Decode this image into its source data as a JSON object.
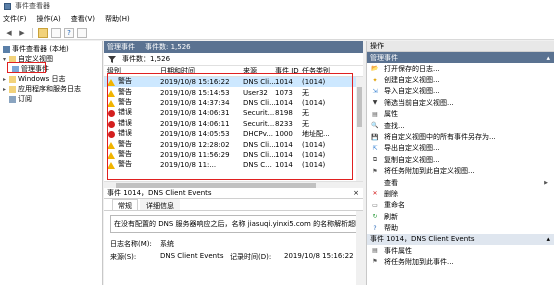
{
  "window": {
    "title": "事件查看器"
  },
  "menu": [
    "文件(F)",
    "操作(A)",
    "查看(V)",
    "帮助(H)"
  ],
  "tree": {
    "root": "事件查看器 (本地)",
    "custom_views": "自定义视图",
    "admin_events": "管理事件",
    "windows_logs": "Windows 日志",
    "app_logs": "应用程序和服务日志",
    "subscriptions": "订阅"
  },
  "center": {
    "header_title": "管理事件",
    "header_count": "事件数: 1,526",
    "filter_text": "事件数：1,526",
    "columns": [
      "级别",
      "日期和时间",
      "来源",
      "事件 ID",
      "任务类别"
    ],
    "rows": [
      {
        "level": "警告",
        "type": "warn",
        "time": "2019/10/8 15:16:22",
        "source": "DNS Cli...",
        "id": "1014",
        "task": "(1014)"
      },
      {
        "level": "警告",
        "type": "warn",
        "time": "2019/10/8 15:14:53",
        "source": "User32",
        "id": "1073",
        "task": "无"
      },
      {
        "level": "警告",
        "type": "warn",
        "time": "2019/10/8 14:37:34",
        "source": "DNS Cli...",
        "id": "1014",
        "task": "(1014)"
      },
      {
        "level": "错误",
        "type": "err",
        "time": "2019/10/8 14:06:31",
        "source": "Securit...",
        "id": "8198",
        "task": "无"
      },
      {
        "level": "错误",
        "type": "err",
        "time": "2019/10/8 14:06:11",
        "source": "Securit...",
        "id": "8233",
        "task": "无"
      },
      {
        "level": "错误",
        "type": "err",
        "time": "2019/10/8 14:05:53",
        "source": "DHCPv...",
        "id": "1000",
        "task": "地址配..."
      },
      {
        "level": "警告",
        "type": "warn",
        "time": "2019/10/8 12:28:02",
        "source": "DNS Cli...",
        "id": "1014",
        "task": "(1014)"
      },
      {
        "level": "警告",
        "type": "warn",
        "time": "2019/10/8 11:56:29",
        "source": "DNS Cli...",
        "id": "1014",
        "task": "(1014)"
      },
      {
        "level": "警告",
        "type": "warn",
        "time": "2019/10/8 11:...",
        "source": "DNS C...",
        "id": "1014",
        "task": "(1014)"
      }
    ],
    "detail_title": "事件 1014，DNS Client Events",
    "tab_general": "常规",
    "tab_details": "详细信息",
    "message": "在没有配置的 DNS 服务器响应之后，名称 jiasuqi.yinxi5.com 的名称解析超时。",
    "log_name_label": "日志名称(M):",
    "log_name_value": "系统",
    "source_label": "来源(S):",
    "source_value": "DNS Client Events",
    "logged_label": "记录时间(D):",
    "logged_value": "2019/10/8 15:16:22"
  },
  "actions": {
    "header": "操作",
    "section1": "管理事件",
    "items1": [
      "打开保存的日志...",
      "创建自定义视图...",
      "导入自定义视图...",
      "筛选当前自定义视图...",
      "属性",
      "查找...",
      "将自定义视图中的所有事件另存为...",
      "导出自定义视图...",
      "复制自定义视图...",
      "将任务附加到此自定义视图...",
      "查看",
      "删除",
      "重命名",
      "刷新",
      "帮助"
    ],
    "section2": "事件 1014，DNS Client Events",
    "items2": [
      "事件属性",
      "将任务附加到此事件..."
    ]
  }
}
